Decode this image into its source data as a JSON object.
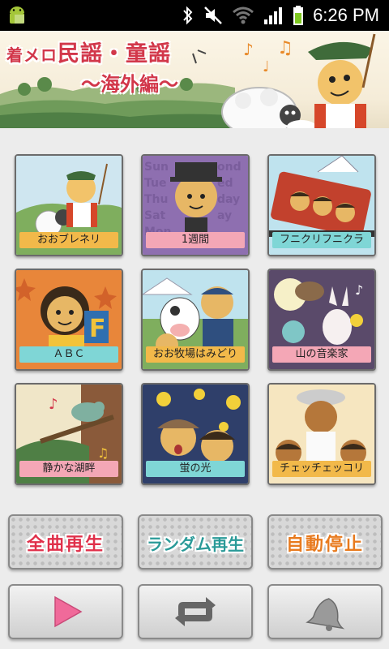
{
  "status_bar": {
    "time": "6:26 PM"
  },
  "banner": {
    "title_part1": "着メロ",
    "title_part2": "民謡・童謡",
    "subtitle": "〜海外編〜"
  },
  "songs": [
    {
      "label": "おおブレネリ",
      "label_color": "#f2b94a"
    },
    {
      "label": "1週間",
      "label_color": "#f4a7b6"
    },
    {
      "label": "フニクリフニクラ",
      "label_color": "#7fd6d6"
    },
    {
      "label": "ＡＢＣ",
      "label_color": "#7fd6d6"
    },
    {
      "label": "おお牧場はみどり",
      "label_color": "#f2b94a"
    },
    {
      "label": "山の音楽家",
      "label_color": "#f4a7b6"
    },
    {
      "label": "静かな湖畔",
      "label_color": "#f4a7b6"
    },
    {
      "label": "蛍の光",
      "label_color": "#7fd6d6"
    },
    {
      "label": "チェッチェッコリ",
      "label_color": "#f2b94a"
    }
  ],
  "mode_buttons": {
    "all": {
      "label": "全曲再生",
      "color": "#e0304a"
    },
    "random": {
      "label": "ランダム再生",
      "color": "#2a9a98"
    },
    "autostop": {
      "label": "自動停止",
      "color": "#e87a1e"
    }
  },
  "controls": {
    "play_icon": "play-icon",
    "repeat_icon": "repeat-icon",
    "bell_icon": "bell-icon"
  }
}
